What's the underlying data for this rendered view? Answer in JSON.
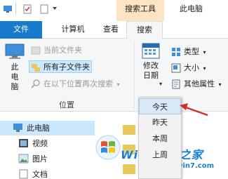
{
  "titlebar": {
    "context_label": "搜索工具",
    "window_title": "此电脑"
  },
  "tabs": {
    "file": "文件",
    "computer": "计算机",
    "view": "查看",
    "search": "搜索"
  },
  "ribbon": {
    "this_pc": "此电脑",
    "current_folder": "当前文件夹",
    "all_subfolders": "所有子文件夹",
    "search_again": "在以下位置再次搜索",
    "location_group": "位置",
    "modified_date": "修改日期",
    "type": "类型",
    "size": "大小",
    "other_properties": "其他属性"
  },
  "dropdown": {
    "items": [
      "今天",
      "昨天",
      "本周",
      "上周"
    ]
  },
  "nav": {
    "items": [
      "此电脑",
      "视频",
      "图片",
      "文档"
    ]
  },
  "watermark": {
    "brand": "Win7系统之家",
    "url": "Www.Winwin7.com"
  },
  "colors": {
    "accent": "#1979ca",
    "context_tab": "#fbe3c4",
    "arrow": "#d32f2f"
  }
}
